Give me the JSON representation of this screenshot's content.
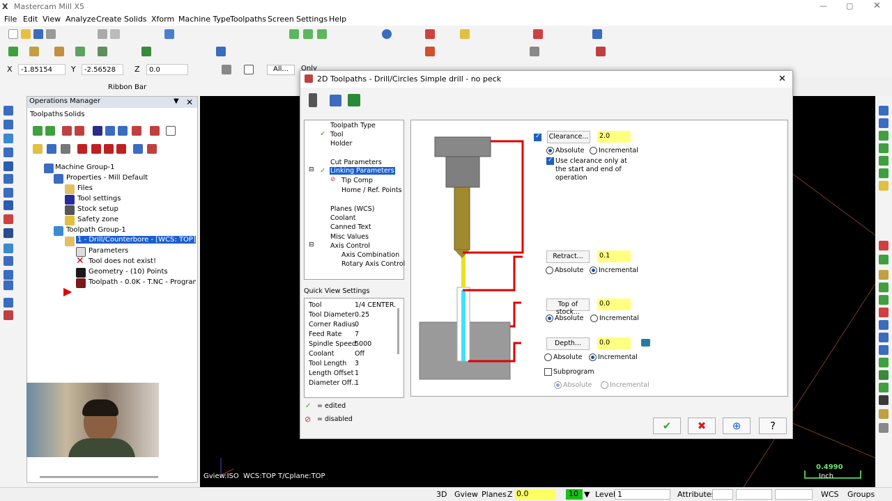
{
  "app": {
    "title": "Mastercam Mill X5"
  },
  "menu": [
    "File",
    "Edit",
    "View",
    "Analyze",
    "Create",
    "Solids",
    "Xform",
    "Machine Type",
    "Toolpaths",
    "Screen",
    "Settings",
    "Help"
  ],
  "coords": {
    "x_label": "X",
    "x_value": "-1.85154",
    "y_label": "Y",
    "y_value": "-2.56528",
    "z_label": "Z",
    "z_value": "0.0",
    "all_label": "All...",
    "only_label": "Only"
  },
  "ribbon_label": "Ribbon Bar",
  "ops_manager": {
    "title": "Operations Manager",
    "tabs": [
      "Toolpaths",
      "Solids"
    ],
    "tree": [
      {
        "label": "Machine Group-1"
      },
      {
        "label": "Properties - Mill Default"
      },
      {
        "label": "Files"
      },
      {
        "label": "Tool settings"
      },
      {
        "label": "Stock setup"
      },
      {
        "label": "Safety zone"
      },
      {
        "label": "Toolpath Group-1"
      },
      {
        "label": "1 - Drill/Counterbore - [WCS: TOP] - [T"
      },
      {
        "label": "Parameters"
      },
      {
        "label": "Tool does not exist!"
      },
      {
        "label": "Geometry - (10) Points"
      },
      {
        "label": "Toolpath - 0.0K - T.NC - Program #"
      }
    ]
  },
  "dialog": {
    "title": "2D Toolpaths - Drill/Circles Simple drill - no peck",
    "tree": [
      "Toolpath Type",
      "Tool",
      "Holder",
      "Cut Parameters",
      "Linking Parameters",
      "Tip Comp",
      "Home / Ref. Points",
      "Planes (WCS)",
      "Coolant",
      "Canned Text",
      "Misc Values",
      "Axis Control",
      "Axis Combination",
      "Rotary Axis Control"
    ],
    "quick_view_title": "Quick View Settings",
    "quick_view": [
      {
        "k": "Tool",
        "v": "1/4 CENTER."
      },
      {
        "k": "Tool Diameter",
        "v": "0.25"
      },
      {
        "k": "Corner Radius",
        "v": "0"
      },
      {
        "k": "Feed Rate",
        "v": "7"
      },
      {
        "k": "Spindle Speed",
        "v": "5000"
      },
      {
        "k": "Coolant",
        "v": "Off"
      },
      {
        "k": "Tool Length",
        "v": "3"
      },
      {
        "k": "Length Offset",
        "v": "1"
      },
      {
        "k": "Diameter Off...",
        "v": "1"
      }
    ],
    "legend_edited": "= edited",
    "legend_disabled": "= disabled",
    "clearance": {
      "label": "Clearance...",
      "value": "2.0",
      "absolute": "Absolute",
      "incremental": "Incremental",
      "use_note": "Use clearance only at the start and end of operation"
    },
    "retract": {
      "label": "Retract...",
      "value": "0.1",
      "absolute": "Absolute",
      "incremental": "Incremental"
    },
    "top_of_stock": {
      "label": "Top of stock...",
      "value": "0.0",
      "absolute": "Absolute",
      "incremental": "Incremental"
    },
    "depth": {
      "label": "Depth...",
      "value": "0.0",
      "absolute": "Absolute",
      "incremental": "Incremental"
    },
    "subprogram": {
      "label": "Subprogram",
      "absolute": "Absolute",
      "incremental": "Incremental"
    }
  },
  "viewport": {
    "gview": "Gview:ISO",
    "wcs": "WCS:TOP",
    "tcplane": "T/Cplane:TOP",
    "scale_value": "0.4990",
    "scale_unit": "Inch"
  },
  "status": {
    "mode": "3D",
    "gview": "Gview",
    "planes": "Planes",
    "z_label": "Z",
    "z_value": "0.0",
    "level_num": "10",
    "level_label": "Level",
    "level_value": "1",
    "attributes": "Attributes",
    "wcs": "WCS",
    "groups": "Groups"
  }
}
